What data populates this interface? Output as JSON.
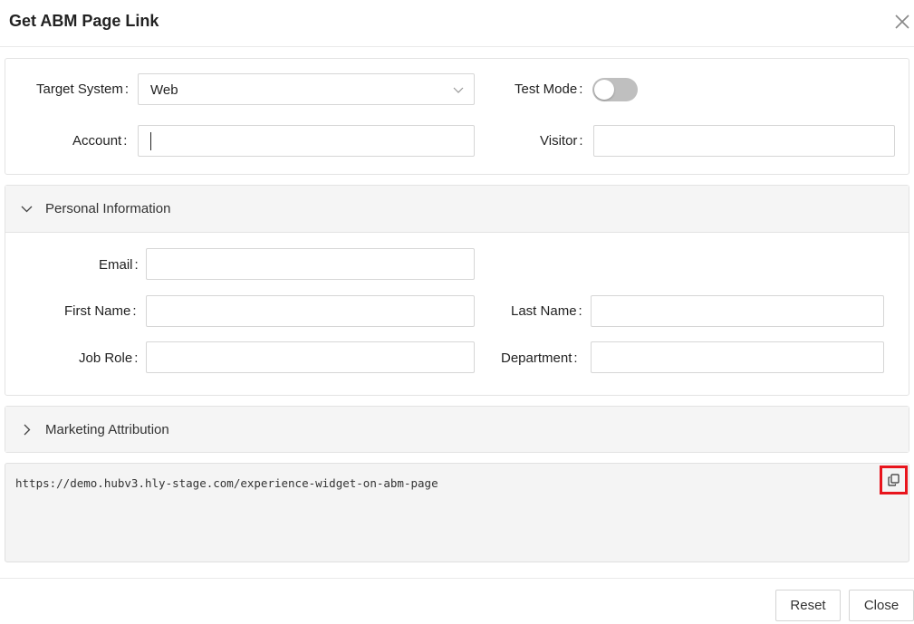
{
  "dialog": {
    "title": "Get ABM Page Link"
  },
  "form": {
    "target_system_label": "Target System",
    "target_system_value": "Web",
    "test_mode_label": "Test Mode",
    "test_mode_on": false,
    "account_label": "Account",
    "account_value": "",
    "visitor_label": "Visitor",
    "visitor_value": "",
    "colon": ":"
  },
  "personal": {
    "title": "Personal Information",
    "expanded": true,
    "email_label": "Email",
    "first_name_label": "First Name",
    "last_name_label": "Last Name",
    "job_role_label": "Job Role",
    "department_label": "Department"
  },
  "marketing": {
    "title": "Marketing Attribution",
    "expanded": false
  },
  "link": {
    "url": "https://demo.hubv3.hly-stage.com/experience-widget-on-abm-page"
  },
  "footer": {
    "reset_label": "Reset",
    "close_label": "Close"
  },
  "colors": {
    "highlight": "#e8141c",
    "toggle_off": "#bfbfbf",
    "panel_header": "#f5f5f5"
  }
}
